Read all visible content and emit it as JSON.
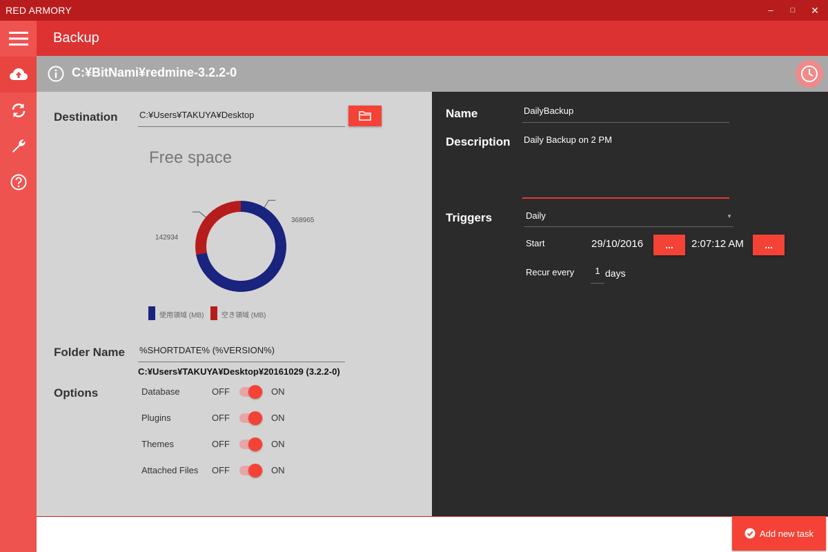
{
  "window": {
    "title": "RED ARMORY",
    "minimize": "–",
    "maximize": "□",
    "close": "✕"
  },
  "sidebar": {
    "items": [
      {
        "icon": "hamburger-menu-icon"
      },
      {
        "icon": "cloud-upload-icon",
        "active": true
      },
      {
        "icon": "sync-icon"
      },
      {
        "icon": "wrench-icon"
      },
      {
        "icon": "help-icon"
      }
    ]
  },
  "header": {
    "title": "Backup"
  },
  "pathbar": {
    "path": "C:¥BitNami¥redmine-3.2.2-0"
  },
  "destination": {
    "label": "Destination",
    "value": "C:¥Users¥TAKUYA¥Desktop"
  },
  "free_space": {
    "title": "Free space",
    "used_label": "368965",
    "free_label": "142934",
    "legend_used": "使用領域 (MB)",
    "legend_free": "空き領域 (MB)"
  },
  "chart_data": {
    "type": "pie",
    "title": "Free space",
    "categories": [
      "使用領域 (MB)",
      "空き領域 (MB)"
    ],
    "values": [
      368965,
      142934
    ],
    "colors": [
      "#1a237e",
      "#b71c1c"
    ],
    "donut": true,
    "legend": "bottom"
  },
  "folder": {
    "label": "Folder Name",
    "value": "%SHORTDATE% (%VERSION%)",
    "resolved": "C:¥Users¥TAKUYA¥Desktop¥20161029 (3.2.2-0)"
  },
  "options": {
    "label": "Options",
    "off": "OFF",
    "on": "ON",
    "items": [
      {
        "label": "Database",
        "enabled": true
      },
      {
        "label": "Plugins",
        "enabled": true
      },
      {
        "label": "Themes",
        "enabled": true
      },
      {
        "label": "Attached Files",
        "enabled": true
      }
    ]
  },
  "task": {
    "name_label": "Name",
    "name_value": "DailyBackup",
    "description_label": "Description",
    "description_value": "Daily Backup on 2 PM",
    "triggers_label": "Triggers",
    "trigger_value": "Daily",
    "start_label": "Start",
    "start_date": "29/10/2016",
    "start_time": "2:07:12 AM",
    "picker_label": "...",
    "recur_label": "Recur every",
    "recur_value": "1",
    "recur_unit": "days"
  },
  "footer": {
    "add_task": "Add new task"
  },
  "colors": {
    "accent": "#f44336",
    "title_bar": "#b81c1c",
    "sidebar": "#ef5350",
    "header": "#dc3232"
  }
}
